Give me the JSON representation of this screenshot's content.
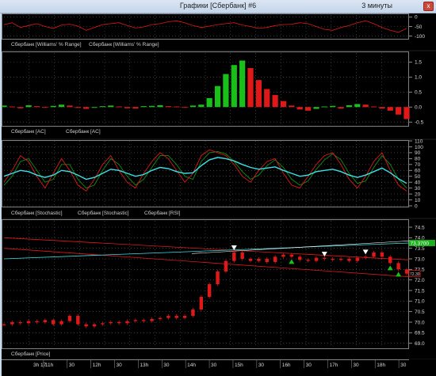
{
  "window": {
    "title": "Графики [Сбербанк] #6",
    "timeframe": "3 минуты",
    "close_glyph": "x",
    "close_icon": "close-icon"
  },
  "panes": {
    "williams": {
      "ticks": [
        "0",
        "-50",
        "-100"
      ],
      "legend": [
        "Сбербанк [Williams' % Range]",
        "Сбербанк [Williams' % Range]"
      ]
    },
    "ac": {
      "ticks": [
        "1.5",
        "1.0",
        "0.5",
        "0.0",
        "-0.5"
      ],
      "legend": [
        "Сбербанк [AC]",
        "Сбербанк [AC]"
      ]
    },
    "osc": {
      "ticks": [
        "110",
        "100",
        "90",
        "80",
        "70",
        "60",
        "50",
        "40",
        "30",
        "20",
        "10",
        "0"
      ],
      "legend": [
        "Сбербанк [Stochastic]",
        "Сбербанк [Stochastic]",
        "Сбербанк [RSI]"
      ]
    },
    "price": {
      "ticks": [
        "74.5",
        "74.0",
        "73.5",
        "73.0",
        "72.5",
        "72.0",
        "71.5",
        "71.0",
        "70.5",
        "70.0",
        "69.5",
        "69.0"
      ],
      "last_price": "73.3700",
      "current_price": "72.30",
      "legend": [
        "Сбербанк [Price]"
      ]
    }
  },
  "xaxis": {
    "day_label": "3h 17",
    "ticks": [
      "11h",
      "30",
      "12h",
      "30",
      "13h",
      "30",
      "14h",
      "30",
      "15h",
      "30",
      "16h",
      "30",
      "17h",
      "30",
      "18h",
      "30"
    ]
  },
  "colors": {
    "red": "#e01818",
    "green": "#19c019",
    "cyan": "#38e0e8",
    "dark_green": "#109010",
    "white": "#ffffff"
  },
  "chart_data": [
    {
      "type": "line",
      "title": "",
      "legend": [
        "Сбербанк [Williams' % Range]",
        "Сбербанк [Williams' % Range]"
      ],
      "ylim": [
        -110,
        10
      ],
      "series": [
        {
          "name": "Сбербанк [Williams' % Range]",
          "values": [
            -40,
            -30,
            -55,
            -45,
            -35,
            -50,
            -60,
            -42,
            -38,
            -48,
            -70,
            -55,
            -40,
            -35,
            -30,
            -45,
            -58,
            -52,
            -40,
            -35,
            -25,
            -20,
            -30,
            -45,
            -55,
            -48,
            -40,
            -35,
            -30,
            -42,
            -50,
            -60,
            -55,
            -45,
            -40,
            -38,
            -30,
            -35,
            -50,
            -65,
            -70,
            -55,
            -45,
            -30,
            -20,
            -35,
            -55,
            -70,
            -80,
            -60
          ]
        }
      ]
    },
    {
      "type": "bar",
      "title": "",
      "legend": [
        "Сбербанк [AC]",
        "Сбербанк [AC]"
      ],
      "ylim": [
        -0.6,
        1.8
      ],
      "series": [
        {
          "name": "Сбербанк [AC]",
          "values": [
            0.05,
            0.02,
            -0.04,
            0.06,
            0.03,
            -0.02,
            0.04,
            0.08,
            0.05,
            -0.03,
            -0.06,
            -0.02,
            0.03,
            0.05,
            0.02,
            -0.04,
            -0.05,
            0.03,
            0.04,
            0.06,
            0.03,
            0.02,
            -0.02,
            0.05,
            0.08,
            0.3,
            0.7,
            1.1,
            1.4,
            1.55,
            1.3,
            0.9,
            0.6,
            0.4,
            0.2,
            0.05,
            -0.08,
            -0.12,
            -0.06,
            0.02,
            0.04,
            -0.05,
            0.06,
            0.1,
            0.08,
            0.02,
            -0.05,
            -0.12,
            -0.25,
            -0.4
          ]
        }
      ]
    },
    {
      "type": "line",
      "title": "",
      "legend": [
        "Сбербанк [Stochastic]",
        "Сбербанк [Stochastic]",
        "Сбербанк [RSI]"
      ],
      "ylim": [
        0,
        110
      ],
      "series": [
        {
          "name": "Сбербанк [Stochastic]",
          "values": [
            40,
            60,
            85,
            75,
            50,
            30,
            55,
            80,
            60,
            35,
            25,
            45,
            70,
            85,
            60,
            40,
            30,
            55,
            75,
            90,
            80,
            60,
            40,
            55,
            85,
            95,
            90,
            85,
            70,
            50,
            40,
            60,
            75,
            80,
            55,
            35,
            30,
            50,
            70,
            85,
            90,
            70,
            45,
            30,
            50,
            75,
            90,
            60,
            35,
            25
          ]
        },
        {
          "name": "Сбербанк [Stochastic]",
          "values": [
            35,
            50,
            75,
            80,
            60,
            40,
            45,
            70,
            70,
            45,
            30,
            35,
            60,
            80,
            70,
            50,
            35,
            45,
            65,
            85,
            85,
            70,
            50,
            45,
            75,
            90,
            92,
            88,
            75,
            58,
            45,
            52,
            68,
            78,
            65,
            45,
            35,
            42,
            62,
            78,
            88,
            78,
            55,
            38,
            42,
            65,
            85,
            70,
            45,
            30
          ]
        },
        {
          "name": "Сбербанк [RSI]",
          "values": [
            50,
            55,
            60,
            58,
            52,
            48,
            52,
            60,
            58,
            52,
            45,
            48,
            55,
            62,
            60,
            55,
            50,
            53,
            60,
            65,
            63,
            58,
            55,
            56,
            68,
            78,
            82,
            80,
            76,
            70,
            65,
            62,
            64,
            66,
            60,
            55,
            50,
            52,
            58,
            60,
            62,
            58,
            52,
            48,
            52,
            58,
            64,
            56,
            46,
            38
          ]
        }
      ]
    },
    {
      "type": "line",
      "title": "",
      "legend": [
        "Сбербанк [Price]"
      ],
      "ylim": [
        68.8,
        74.8
      ],
      "series": [
        {
          "name": "Сбербанк [Price]",
          "values": [
            69.9,
            70.0,
            69.95,
            70.05,
            70.0,
            70.1,
            69.9,
            70.05,
            70.3,
            69.9,
            69.8,
            69.9,
            69.95,
            70.0,
            69.95,
            70.05,
            70.1,
            70.05,
            70.15,
            70.2,
            70.3,
            70.2,
            70.3,
            70.6,
            71.2,
            71.8,
            72.4,
            72.9,
            73.3,
            73.0,
            72.9,
            73.0,
            72.85,
            73.1,
            73.2,
            73.1,
            72.95,
            72.9,
            73.05,
            73.0,
            72.95,
            73.0,
            72.9,
            73.05,
            73.1,
            73.3,
            73.1,
            72.8,
            72.5,
            72.3
          ]
        }
      ]
    }
  ]
}
